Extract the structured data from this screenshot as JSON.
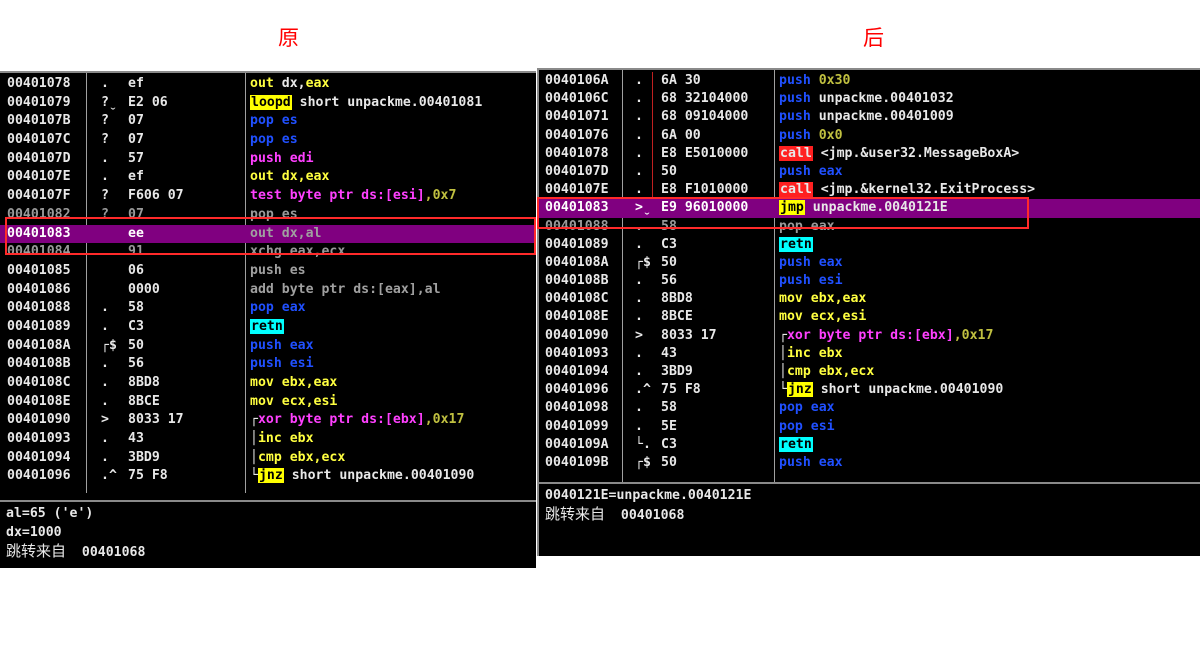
{
  "captions": {
    "left": "原",
    "right": "后"
  },
  "colors": {
    "white": "#e8e8e8",
    "yellow": "#ffff40",
    "blue": "#2050ff",
    "magenta": "#ff40ff",
    "olive": "#c0c040",
    "grey": "#a0a0a0",
    "call_bg": "#ff2020",
    "jmp_bg": "#ffff00",
    "retn_bg": "#00ffff",
    "highlight": "#800080"
  },
  "left": {
    "rows": [
      {
        "addr": "00401078",
        "mark": ".",
        "hex": "ef",
        "code": [
          {
            "t": "out ",
            "c": "yellow"
          },
          {
            "t": "dx",
            "c": "white"
          },
          {
            "t": ",",
            "c": "white"
          },
          {
            "t": "eax",
            "c": "yellow"
          }
        ]
      },
      {
        "addr": "00401079",
        "mark": "?ˬ",
        "hex": "E2 06",
        "code": [
          {
            "t": "loopd",
            "c": "black",
            "bg": "jmp_bg"
          },
          {
            "t": " short unpackme.00401081",
            "c": "white"
          }
        ]
      },
      {
        "addr": "0040107B",
        "mark": "?",
        "hex": "07",
        "code": [
          {
            "t": "pop es",
            "c": "blue"
          }
        ]
      },
      {
        "addr": "0040107C",
        "mark": "?",
        "hex": "07",
        "code": [
          {
            "t": "pop es",
            "c": "blue"
          }
        ]
      },
      {
        "addr": "0040107D",
        "mark": ".",
        "hex": "57",
        "code": [
          {
            "t": "push edi",
            "c": "magenta"
          }
        ]
      },
      {
        "addr": "0040107E",
        "mark": ".",
        "hex": "ef",
        "code": [
          {
            "t": "out dx,eax",
            "c": "yellow"
          }
        ]
      },
      {
        "addr": "0040107F",
        "mark": "?",
        "hex": "F606 07",
        "code": [
          {
            "t": "test byte ptr ds:[esi]",
            "c": "magenta"
          },
          {
            "t": ",0x7",
            "c": "olive"
          }
        ]
      },
      {
        "addr": "00401082",
        "mark": "?",
        "hex": "07",
        "code": [
          {
            "t": "pop es",
            "c": "blue"
          }
        ],
        "grey": true
      },
      {
        "addr": "00401083",
        "mark": "",
        "hex": "ee",
        "code": [
          {
            "t": "out dx,al",
            "c": "grey"
          }
        ],
        "hl": true
      },
      {
        "addr": "00401084",
        "mark": "",
        "hex": "91",
        "code": [
          {
            "t": "xchg eax,ecx",
            "c": "grey"
          }
        ],
        "grey": true
      },
      {
        "addr": "00401085",
        "mark": "",
        "hex": "06",
        "code": [
          {
            "t": "push es",
            "c": "grey"
          }
        ]
      },
      {
        "addr": "00401086",
        "mark": "",
        "hex": "0000",
        "code": [
          {
            "t": "add byte ptr ds:[eax],al",
            "c": "grey"
          }
        ]
      },
      {
        "addr": "00401088",
        "mark": ".",
        "hex": "58",
        "code": [
          {
            "t": "pop eax",
            "c": "blue"
          }
        ]
      },
      {
        "addr": "00401089",
        "mark": ".",
        "hex": "C3",
        "code": [
          {
            "t": "retn",
            "c": "black",
            "bg": "retn_bg"
          }
        ]
      },
      {
        "addr": "0040108A",
        "mark": "┌$",
        "hex": "50",
        "code": [
          {
            "t": "push eax",
            "c": "blue"
          }
        ]
      },
      {
        "addr": "0040108B",
        "mark": ".",
        "hex": "56",
        "code": [
          {
            "t": "push esi",
            "c": "blue"
          }
        ]
      },
      {
        "addr": "0040108C",
        "mark": ".",
        "hex": "8BD8",
        "code": [
          {
            "t": "mov ebx,eax",
            "c": "yellow"
          }
        ]
      },
      {
        "addr": "0040108E",
        "mark": ".",
        "hex": "8BCE",
        "code": [
          {
            "t": "mov ecx,esi",
            "c": "yellow"
          }
        ]
      },
      {
        "addr": "00401090",
        "mark": ">",
        "hex": "8033 17",
        "code": [
          {
            "t": "┌",
            "c": "white"
          },
          {
            "t": "xor byte ptr ds:[ebx]",
            "c": "magenta"
          },
          {
            "t": ",0x17",
            "c": "olive"
          }
        ]
      },
      {
        "addr": "00401093",
        "mark": ".",
        "hex": "43",
        "code": [
          {
            "t": "│",
            "c": "white"
          },
          {
            "t": "inc ebx",
            "c": "yellow"
          }
        ]
      },
      {
        "addr": "00401094",
        "mark": ".",
        "hex": "3BD9",
        "code": [
          {
            "t": "│",
            "c": "white"
          },
          {
            "t": "cmp ebx,ecx",
            "c": "yellow"
          }
        ]
      },
      {
        "addr": "00401096",
        "mark": ".^",
        "hex": "75 F8",
        "code": [
          {
            "t": "└",
            "c": "white"
          },
          {
            "t": "jnz",
            "c": "black",
            "bg": "jmp_bg"
          },
          {
            "t": " short unpackme.00401090",
            "c": "white"
          }
        ]
      }
    ],
    "info": [
      "al=65 ('e')",
      "dx=1000"
    ],
    "info_zh": "跳转来自",
    "info_addr": "00401068"
  },
  "right": {
    "rows": [
      {
        "addr": "0040106A",
        "mark": ".",
        "hex": "6A 30",
        "code": [
          {
            "t": "push ",
            "c": "blue"
          },
          {
            "t": "0x30",
            "c": "olive"
          }
        ]
      },
      {
        "addr": "0040106C",
        "mark": ".",
        "hex": "68 32104000",
        "code": [
          {
            "t": "push ",
            "c": "blue"
          },
          {
            "t": "unpackme.00401032",
            "c": "white"
          }
        ]
      },
      {
        "addr": "00401071",
        "mark": ".",
        "hex": "68 09104000",
        "code": [
          {
            "t": "push ",
            "c": "blue"
          },
          {
            "t": "unpackme.00401009",
            "c": "white"
          }
        ]
      },
      {
        "addr": "00401076",
        "mark": ".",
        "hex": "6A 00",
        "code": [
          {
            "t": "push ",
            "c": "blue"
          },
          {
            "t": "0x0",
            "c": "olive"
          }
        ]
      },
      {
        "addr": "00401078",
        "mark": ".",
        "hex": "E8 E5010000",
        "code": [
          {
            "t": "call",
            "c": "white",
            "bg": "call_bg"
          },
          {
            "t": " <jmp.&user32.MessageBoxA>",
            "c": "white"
          }
        ]
      },
      {
        "addr": "0040107D",
        "mark": ".",
        "hex": "50",
        "code": [
          {
            "t": "push eax",
            "c": "blue"
          }
        ]
      },
      {
        "addr": "0040107E",
        "mark": ".",
        "hex": "E8 F1010000",
        "code": [
          {
            "t": "call",
            "c": "white",
            "bg": "call_bg"
          },
          {
            "t": " <jmp.&kernel32.ExitProcess>",
            "c": "white"
          }
        ]
      },
      {
        "addr": "00401083",
        "mark": ">ˬ",
        "hex": "E9 96010000",
        "code": [
          {
            "t": "jmp",
            "c": "black",
            "bg": "jmp_bg"
          },
          {
            "t": " unpackme.0040121E",
            "c": "white"
          }
        ],
        "hl": true
      },
      {
        "addr": "00401088",
        "mark": ".",
        "hex": "58",
        "code": [
          {
            "t": "pop eax",
            "c": "blue"
          }
        ],
        "grey": true
      },
      {
        "addr": "00401089",
        "mark": ".",
        "hex": "C3",
        "code": [
          {
            "t": "retn",
            "c": "black",
            "bg": "retn_bg"
          }
        ]
      },
      {
        "addr": "0040108A",
        "mark": "┌$",
        "hex": "50",
        "code": [
          {
            "t": "push eax",
            "c": "blue"
          }
        ]
      },
      {
        "addr": "0040108B",
        "mark": ".",
        "hex": "56",
        "code": [
          {
            "t": "push esi",
            "c": "blue"
          }
        ]
      },
      {
        "addr": "0040108C",
        "mark": ".",
        "hex": "8BD8",
        "code": [
          {
            "t": "mov ebx,eax",
            "c": "yellow"
          }
        ]
      },
      {
        "addr": "0040108E",
        "mark": ".",
        "hex": "8BCE",
        "code": [
          {
            "t": "mov ecx,esi",
            "c": "yellow"
          }
        ]
      },
      {
        "addr": "00401090",
        "mark": ">",
        "hex": "8033 17",
        "code": [
          {
            "t": "┌",
            "c": "white"
          },
          {
            "t": "xor byte ptr ds:[ebx]",
            "c": "magenta"
          },
          {
            "t": ",0x17",
            "c": "olive"
          }
        ]
      },
      {
        "addr": "00401093",
        "mark": ".",
        "hex": "43",
        "code": [
          {
            "t": "│",
            "c": "white"
          },
          {
            "t": "inc ebx",
            "c": "yellow"
          }
        ]
      },
      {
        "addr": "00401094",
        "mark": ".",
        "hex": "3BD9",
        "code": [
          {
            "t": "│",
            "c": "white"
          },
          {
            "t": "cmp ebx,ecx",
            "c": "yellow"
          }
        ]
      },
      {
        "addr": "00401096",
        "mark": ".^",
        "hex": "75 F8",
        "code": [
          {
            "t": "└",
            "c": "white"
          },
          {
            "t": "jnz",
            "c": "black",
            "bg": "jmp_bg"
          },
          {
            "t": " short unpackme.00401090",
            "c": "white"
          }
        ]
      },
      {
        "addr": "00401098",
        "mark": ".",
        "hex": "58",
        "code": [
          {
            "t": "pop eax",
            "c": "blue"
          }
        ]
      },
      {
        "addr": "00401099",
        "mark": ".",
        "hex": "5E",
        "code": [
          {
            "t": "pop esi",
            "c": "blue"
          }
        ]
      },
      {
        "addr": "0040109A",
        "mark": "└.",
        "hex": "C3",
        "code": [
          {
            "t": "retn",
            "c": "black",
            "bg": "retn_bg"
          }
        ]
      },
      {
        "addr": "0040109B",
        "mark": "┌$",
        "hex": "50",
        "code": [
          {
            "t": "push eax",
            "c": "blue"
          }
        ]
      }
    ],
    "info": [
      "0040121E=unpackme.0040121E"
    ],
    "info_zh": "跳转来自",
    "info_addr": "00401068"
  }
}
